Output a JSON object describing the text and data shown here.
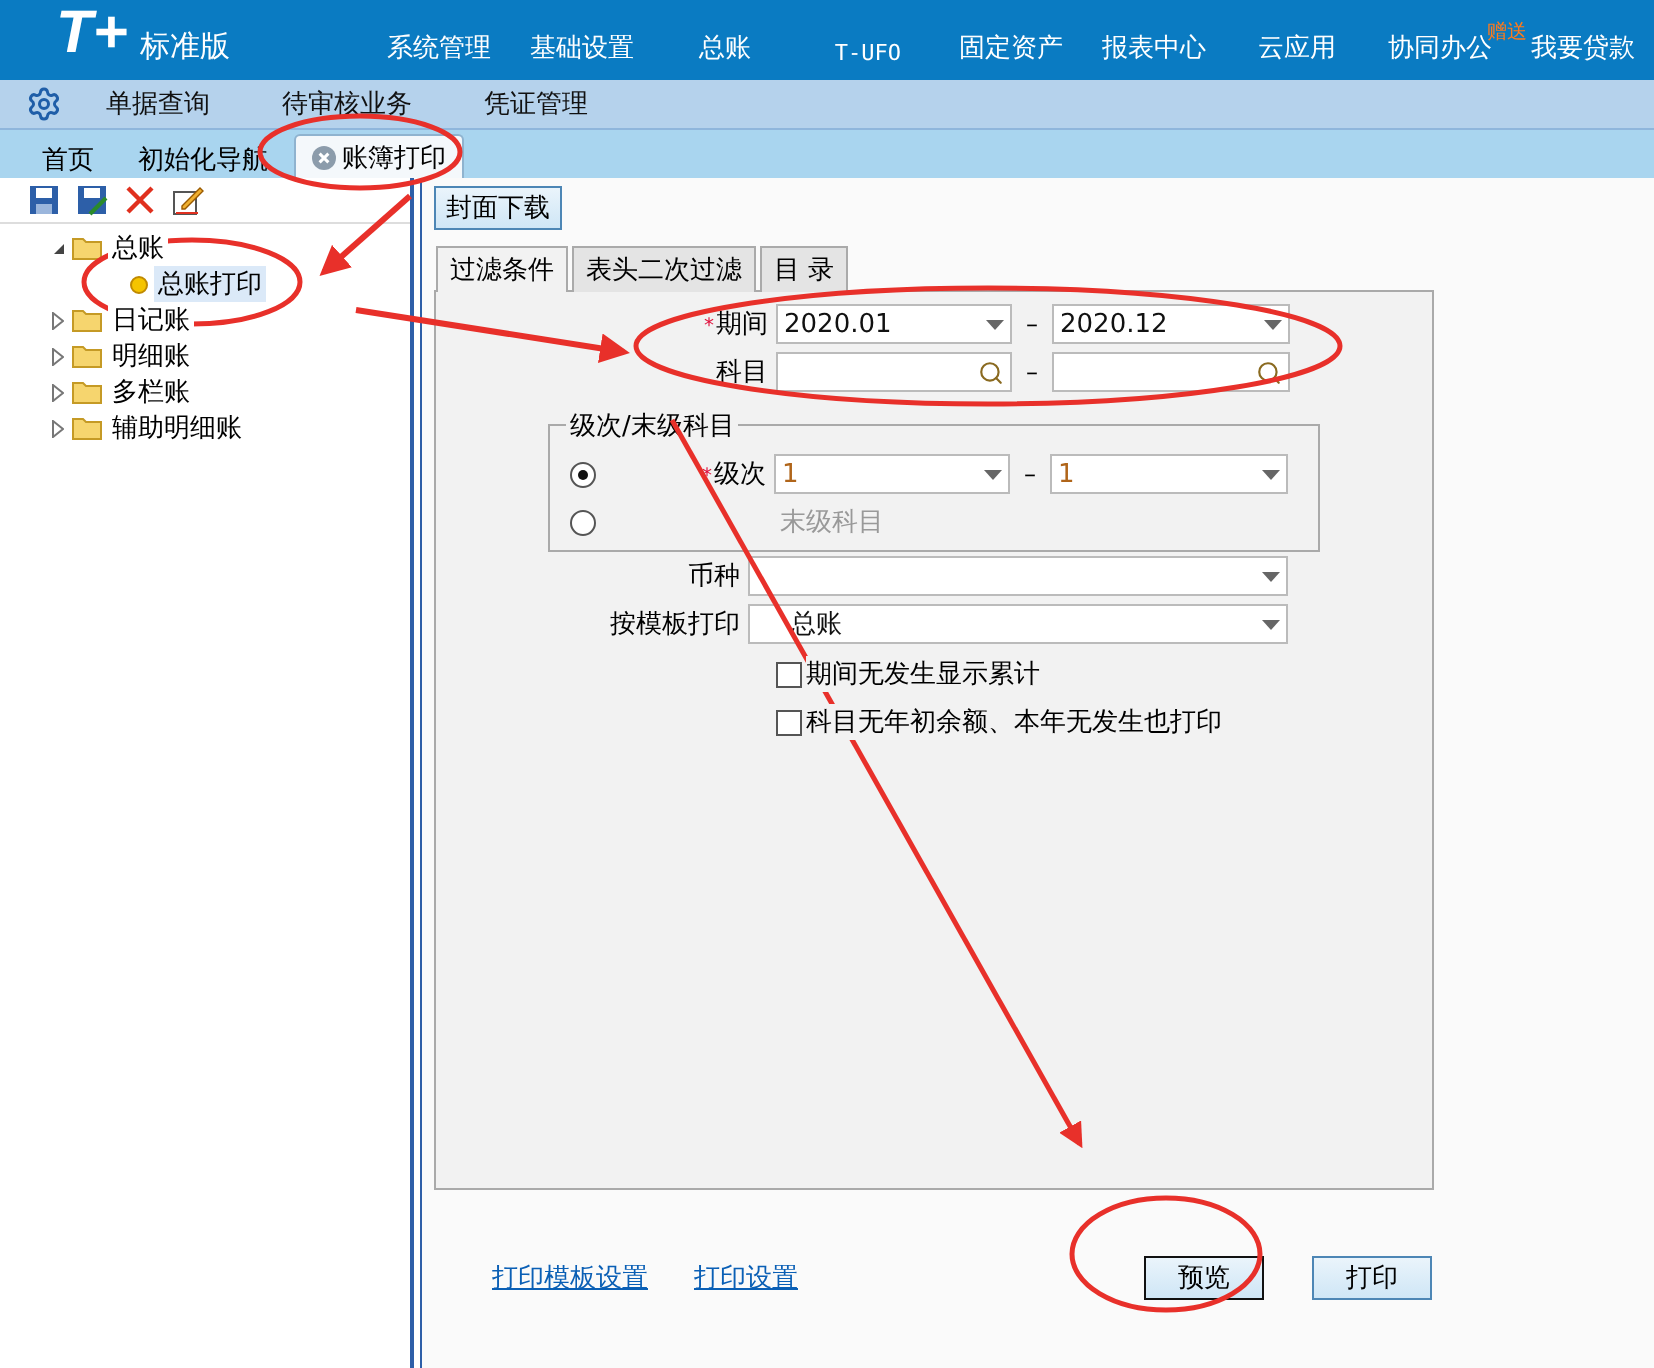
{
  "top_nav": {
    "logo": "T+",
    "edition": "标准版",
    "menus": [
      {
        "label": "系统管理"
      },
      {
        "label": "基础设置"
      },
      {
        "label": "总账"
      },
      {
        "label": "T-UFO",
        "kind": "mono"
      },
      {
        "label": "固定资产"
      },
      {
        "label": "报表中心"
      },
      {
        "label": "云应用"
      },
      {
        "label": "协同办公",
        "badge": "赠送"
      },
      {
        "label": "我要贷款"
      }
    ]
  },
  "sub_nav": [
    "单据查询",
    "待审核业务",
    "凭证管理"
  ],
  "tabs": [
    {
      "label": "首页",
      "selected": false,
      "closable": false
    },
    {
      "label": "初始化导航",
      "selected": false,
      "closable": false
    },
    {
      "label": "账簿打印",
      "selected": true,
      "closable": true
    }
  ],
  "tree": [
    {
      "label": "总账",
      "expanded": true,
      "selected": false,
      "children": [
        {
          "label": "总账打印",
          "selected": true
        }
      ]
    },
    {
      "label": "日记账",
      "expanded": false,
      "selected": false
    },
    {
      "label": "明细账",
      "expanded": false,
      "selected": false
    },
    {
      "label": "多栏账",
      "expanded": false,
      "selected": false
    },
    {
      "label": "辅助明细账",
      "expanded": false,
      "selected": false
    }
  ],
  "cover_download_button": "封面下载",
  "filter_tabs": [
    {
      "label": "过滤条件",
      "selected": true
    },
    {
      "label": "表头二次过滤",
      "selected": false
    },
    {
      "label": "目 录",
      "selected": false
    }
  ],
  "period": {
    "required_mark": "*",
    "label": "期间",
    "from": "2020.01",
    "separator": "–",
    "to": "2020.12"
  },
  "subject": {
    "label": "科目",
    "separator": "–"
  },
  "level_group": {
    "title": "级次/末级科目",
    "options": [
      {
        "kind": "range",
        "required_mark": "*",
        "label": "级次",
        "selected": true,
        "from": "1",
        "separator": "–",
        "to": "1"
      },
      {
        "kind": "plain",
        "label": "末级科目",
        "selected": false
      }
    ]
  },
  "currency": {
    "label": "币种"
  },
  "template": {
    "label": "按模板打印",
    "value": "总账"
  },
  "checkboxes": [
    {
      "label": "期间无发生显示累计",
      "checked": false
    },
    {
      "label": "科目无年初余额、本年无发生也打印",
      "checked": false
    }
  ],
  "links": [
    "打印模板设置",
    "打印设置"
  ],
  "buttons": [
    {
      "label": "预览",
      "focused": true
    },
    {
      "label": "打印",
      "focused": false
    }
  ]
}
